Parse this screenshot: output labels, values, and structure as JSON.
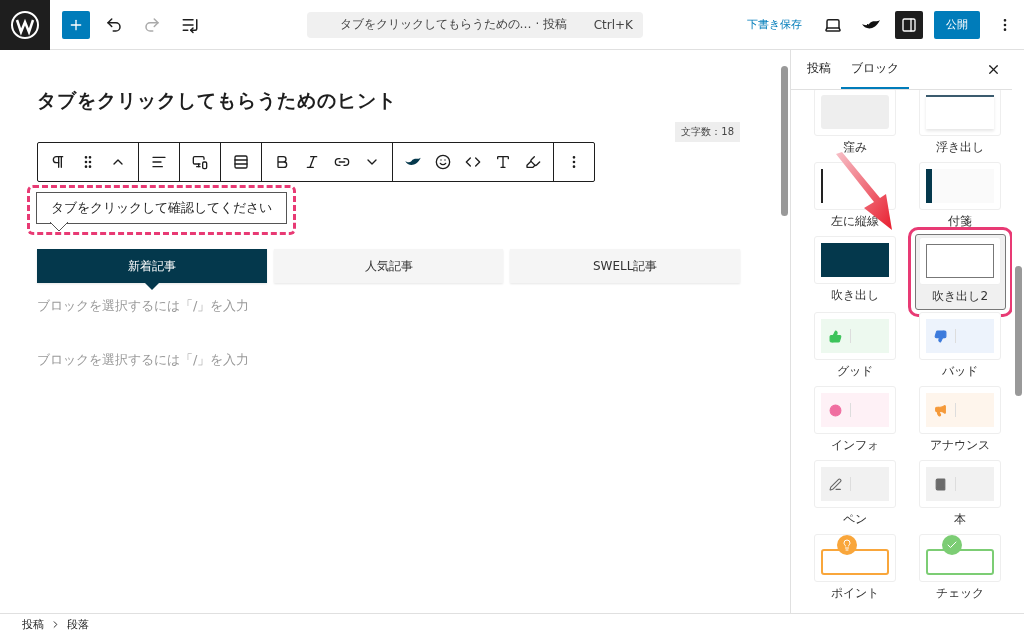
{
  "topbar": {
    "command_search": {
      "title": "タブをクリックしてもらうための…",
      "type": "· 投稿",
      "shortcut": "Ctrl+K"
    },
    "save_draft": "下書き保存",
    "settings_open": true,
    "publish": "公開"
  },
  "editor": {
    "title": "タブをクリックしてもらうためのヒント",
    "char_count": "文字数：18",
    "balloon": "タブをクリックして確認してください",
    "tabs": [
      {
        "label": "新着記事",
        "selected": true
      },
      {
        "label": "人気記事",
        "selected": false
      },
      {
        "label": "SWELL記事",
        "selected": false
      }
    ],
    "placeholders": [
      "ブロックを選択するには「/」を入力",
      "ブロックを選択するには「/」を入力"
    ]
  },
  "sidebar": {
    "tabs": [
      {
        "label": "投稿",
        "selected": false
      },
      {
        "label": "ブロック",
        "selected": true
      }
    ],
    "styles": [
      {
        "kind": "inset",
        "label": "窪み",
        "selected": false
      },
      {
        "kind": "float",
        "label": "浮き出し",
        "selected": false
      },
      {
        "kind": "left-line",
        "label": "左に縦線",
        "selected": false
      },
      {
        "kind": "sticky",
        "label": "付箋",
        "selected": false
      },
      {
        "kind": "balloon",
        "label": "吹き出し",
        "selected": false
      },
      {
        "kind": "balloon-outline",
        "label": "吹き出し2",
        "selected": true
      },
      {
        "kind": "good",
        "label": "グッド",
        "selected": false,
        "color": "#3cc35a"
      },
      {
        "kind": "bad",
        "label": "バッド",
        "selected": false,
        "color": "#3d7bdc"
      },
      {
        "kind": "info",
        "label": "インフォ",
        "selected": false,
        "color": "#f06ea0"
      },
      {
        "kind": "announce",
        "label": "アナウンス",
        "selected": false,
        "color": "#f59a3a"
      },
      {
        "kind": "pen",
        "label": "ペン",
        "selected": false,
        "color": "#666666"
      },
      {
        "kind": "book",
        "label": "本",
        "selected": false,
        "color": "#6b6b6b"
      },
      {
        "kind": "point",
        "label": "ポイント",
        "selected": false,
        "color": "#f9a63b"
      },
      {
        "kind": "check",
        "label": "チェック",
        "selected": false,
        "color": "#7ccd74"
      }
    ]
  },
  "breadcrumb": [
    "投稿",
    "段落"
  ]
}
